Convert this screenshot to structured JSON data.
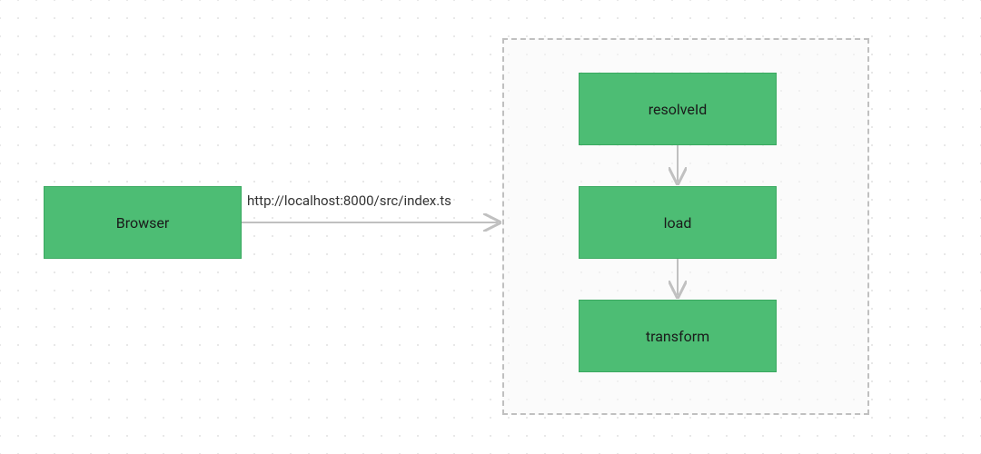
{
  "diagram": {
    "browser": {
      "label": "Browser"
    },
    "request": {
      "url": "http://localhost:8000/src/index.ts"
    },
    "pipeline": {
      "steps": [
        {
          "label": "resolveId"
        },
        {
          "label": "load"
        },
        {
          "label": "transform"
        }
      ]
    }
  },
  "colors": {
    "nodeFill": "#4dbd74",
    "nodeBorder": "#3aa960",
    "arrow": "#c0c0c0",
    "dashedBorder": "#c0c0c0"
  }
}
